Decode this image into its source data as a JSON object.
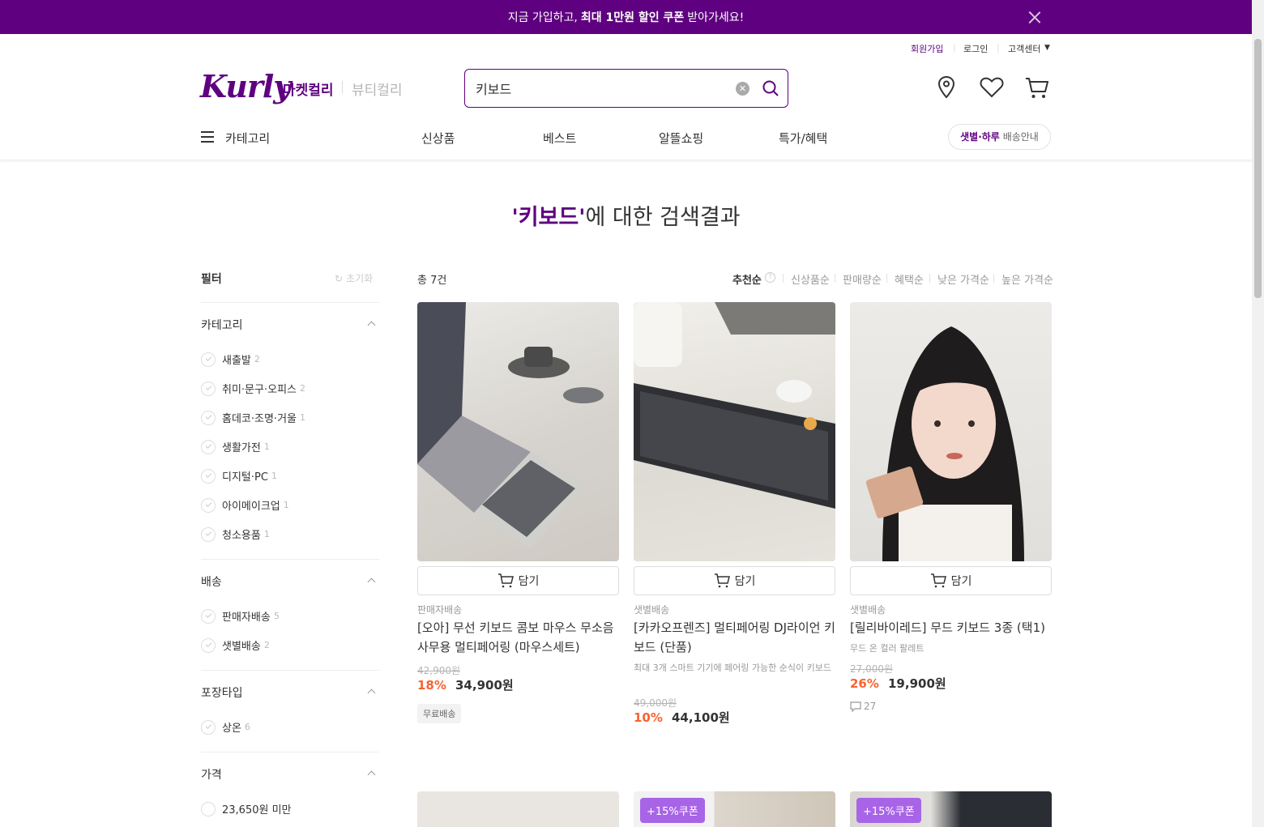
{
  "banner": {
    "pre": "지금 가입하고,",
    "bold": "최대 1만원 할인 쿠폰",
    "post": "받아가세요!"
  },
  "top_links": {
    "signup": "회원가입",
    "login": "로그인",
    "support": "고객센터"
  },
  "header": {
    "logo": "Kurly",
    "tab_market": "마켓컬리",
    "tab_beauty": "뷰티컬리"
  },
  "search": {
    "value": "키보드"
  },
  "nav": {
    "category": "카테고리",
    "items": [
      "신상품",
      "베스트",
      "알뜰쇼핑",
      "특가/혜택"
    ],
    "delivery_bold": "샛별·하루",
    "delivery_text": "배송안내"
  },
  "results": {
    "keyword": "'키보드'",
    "title_suffix": "에 대한 검색결과",
    "total": "총 7건",
    "sort": [
      "추천순",
      "신상품순",
      "판매량순",
      "혜택순",
      "낮은 가격순",
      "높은 가격순"
    ]
  },
  "filter": {
    "title": "필터",
    "reset": "초기화",
    "groups": [
      {
        "title": "카테고리",
        "options": [
          {
            "label": "새출발",
            "count": "2"
          },
          {
            "label": "취미·문구·오피스",
            "count": "2"
          },
          {
            "label": "홈데코·조명·거울",
            "count": "1"
          },
          {
            "label": "생활가전",
            "count": "1"
          },
          {
            "label": "디지털·PC",
            "count": "1"
          },
          {
            "label": "아이메이크업",
            "count": "1"
          },
          {
            "label": "청소용품",
            "count": "1"
          }
        ]
      },
      {
        "title": "배송",
        "options": [
          {
            "label": "판매자배송",
            "count": "5"
          },
          {
            "label": "샛별배송",
            "count": "2"
          }
        ]
      },
      {
        "title": "포장타입",
        "options": [
          {
            "label": "상온",
            "count": "6"
          }
        ]
      },
      {
        "title": "가격",
        "options": [
          {
            "label": "23,650원 미만",
            "count": ""
          }
        ]
      }
    ]
  },
  "cart_label": "담기",
  "products": [
    {
      "delivery": "판매자배송",
      "name": "[오아] 무선 키보드 콤보 마우스 무소음 사무용 멀티페어링 (마우스세트)",
      "original_price": "42,900원",
      "discount": "18%",
      "price": "34,900원",
      "tag": "무료배송"
    },
    {
      "delivery": "샛별배송",
      "name": "[카카오프렌즈] 멀티페어링 DJ라이언 키보드 (단품)",
      "subtitle": "최대 3개 스마트 기기에 페어링 가능한 순식이 키보드",
      "original_price": "49,000원",
      "discount": "10%",
      "price": "44,100원"
    },
    {
      "delivery": "샛별배송",
      "name": "[릴리바이레드] 무드 키보드 3종 (택1)",
      "subtitle": "무드 온 컬러 팔레트",
      "original_price": "27,000원",
      "discount": "26%",
      "price": "19,900원",
      "reviews": "27"
    }
  ],
  "coupons": [
    "+15%쿠폰",
    "+15%쿠폰"
  ],
  "colors": {
    "brand": "#5f0080",
    "discount": "#fa622f"
  }
}
